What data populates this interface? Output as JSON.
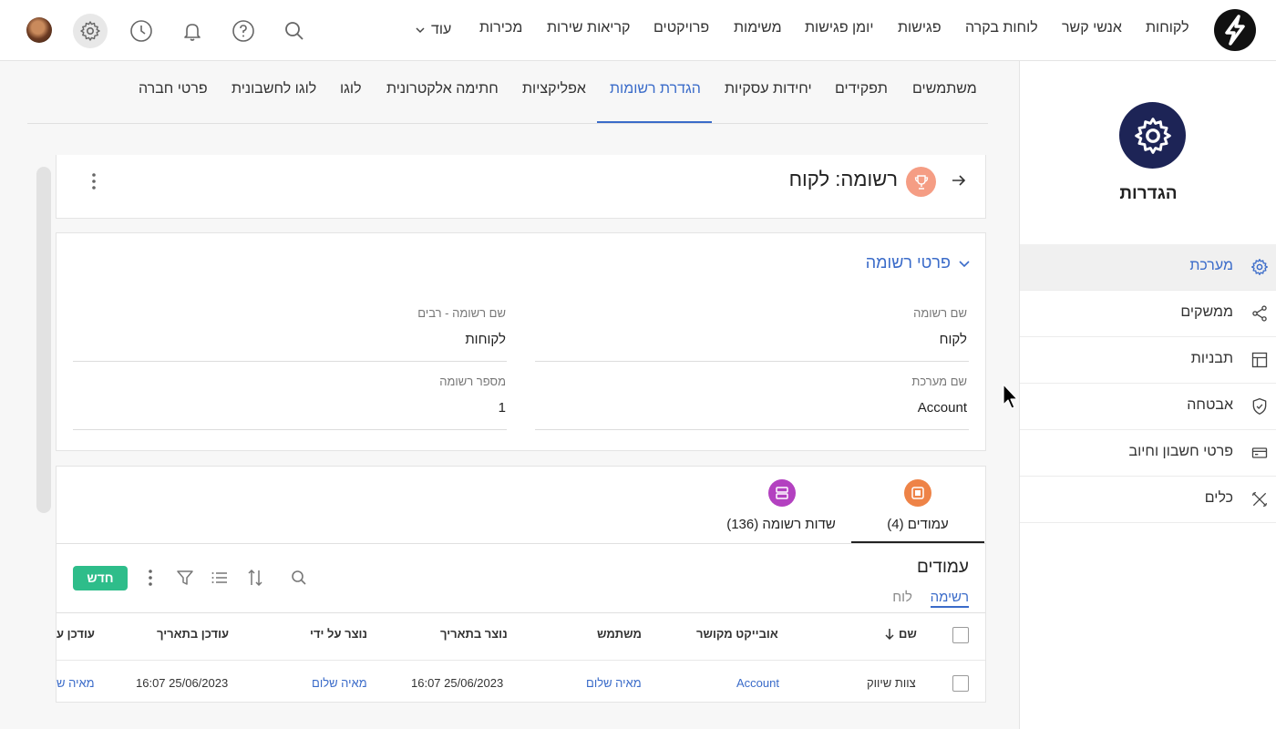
{
  "topnav": {
    "items": [
      "לקוחות",
      "אנשי קשר",
      "לוחות בקרה",
      "פגישות",
      "יומן פגישות",
      "משימות",
      "פרויקטים",
      "קריאות שירות",
      "מכירות",
      "עוד"
    ]
  },
  "sidebar": {
    "title": "הגדרות",
    "items": [
      {
        "label": "מערכת",
        "icon": "gear-icon"
      },
      {
        "label": "ממשקים",
        "icon": "share-icon"
      },
      {
        "label": "תבניות",
        "icon": "layout-icon"
      },
      {
        "label": "אבטחה",
        "icon": "shield-icon"
      },
      {
        "label": "פרטי חשבון וחיוב",
        "icon": "credit-card-icon"
      },
      {
        "label": "כלים",
        "icon": "tools-icon"
      }
    ]
  },
  "tabs": [
    "משתמשים",
    "תפקידים",
    "יחידות עסקיות",
    "הגדרת רשומות",
    "אפליקציות",
    "חתימה אלקטרונית",
    "לוגו",
    "לוגו לחשבונית",
    "פרטי חברה"
  ],
  "record": {
    "title": "רשומה: לקוח"
  },
  "details": {
    "section_title": "פרטי רשומה",
    "fields": {
      "record_name_label": "שם רשומה",
      "record_name_value": "לקוח",
      "record_plural_label": "שם רשומה - רבים",
      "record_plural_value": "לקוחות",
      "system_name_label": "שם מערכת",
      "system_name_value": "Account",
      "record_number_label": "מספר רשומה",
      "record_number_value": "1"
    }
  },
  "subtabs": {
    "columns": "עמודים (4)",
    "fields": "שדות רשומה (136)"
  },
  "list": {
    "title": "עמודים",
    "view_list": "רשימה",
    "view_board": "לוח",
    "new_button": "חדש",
    "headers": [
      "שם",
      "אובייקט מקושר",
      "משתמש",
      "נוצר בתאריך",
      "נוצר על ידי",
      "עודכן בתאריך",
      "עודכן ע"
    ],
    "rows": [
      {
        "name": "צוות שיווק",
        "object": "Account",
        "user": "מאיה שלום",
        "created": "16:07 25/06/2023",
        "created_by": "מאיה שלום",
        "updated": "16:07 25/06/2023",
        "updated_by": "מאיה ש"
      }
    ]
  },
  "colors": {
    "accent": "#3a6bc9",
    "new_button": "#2ebd8a",
    "settings_circle": "#1d2456",
    "trophy": "#f59d84",
    "columns_icon": "#ee8347",
    "fields_icon": "#b341c0"
  }
}
